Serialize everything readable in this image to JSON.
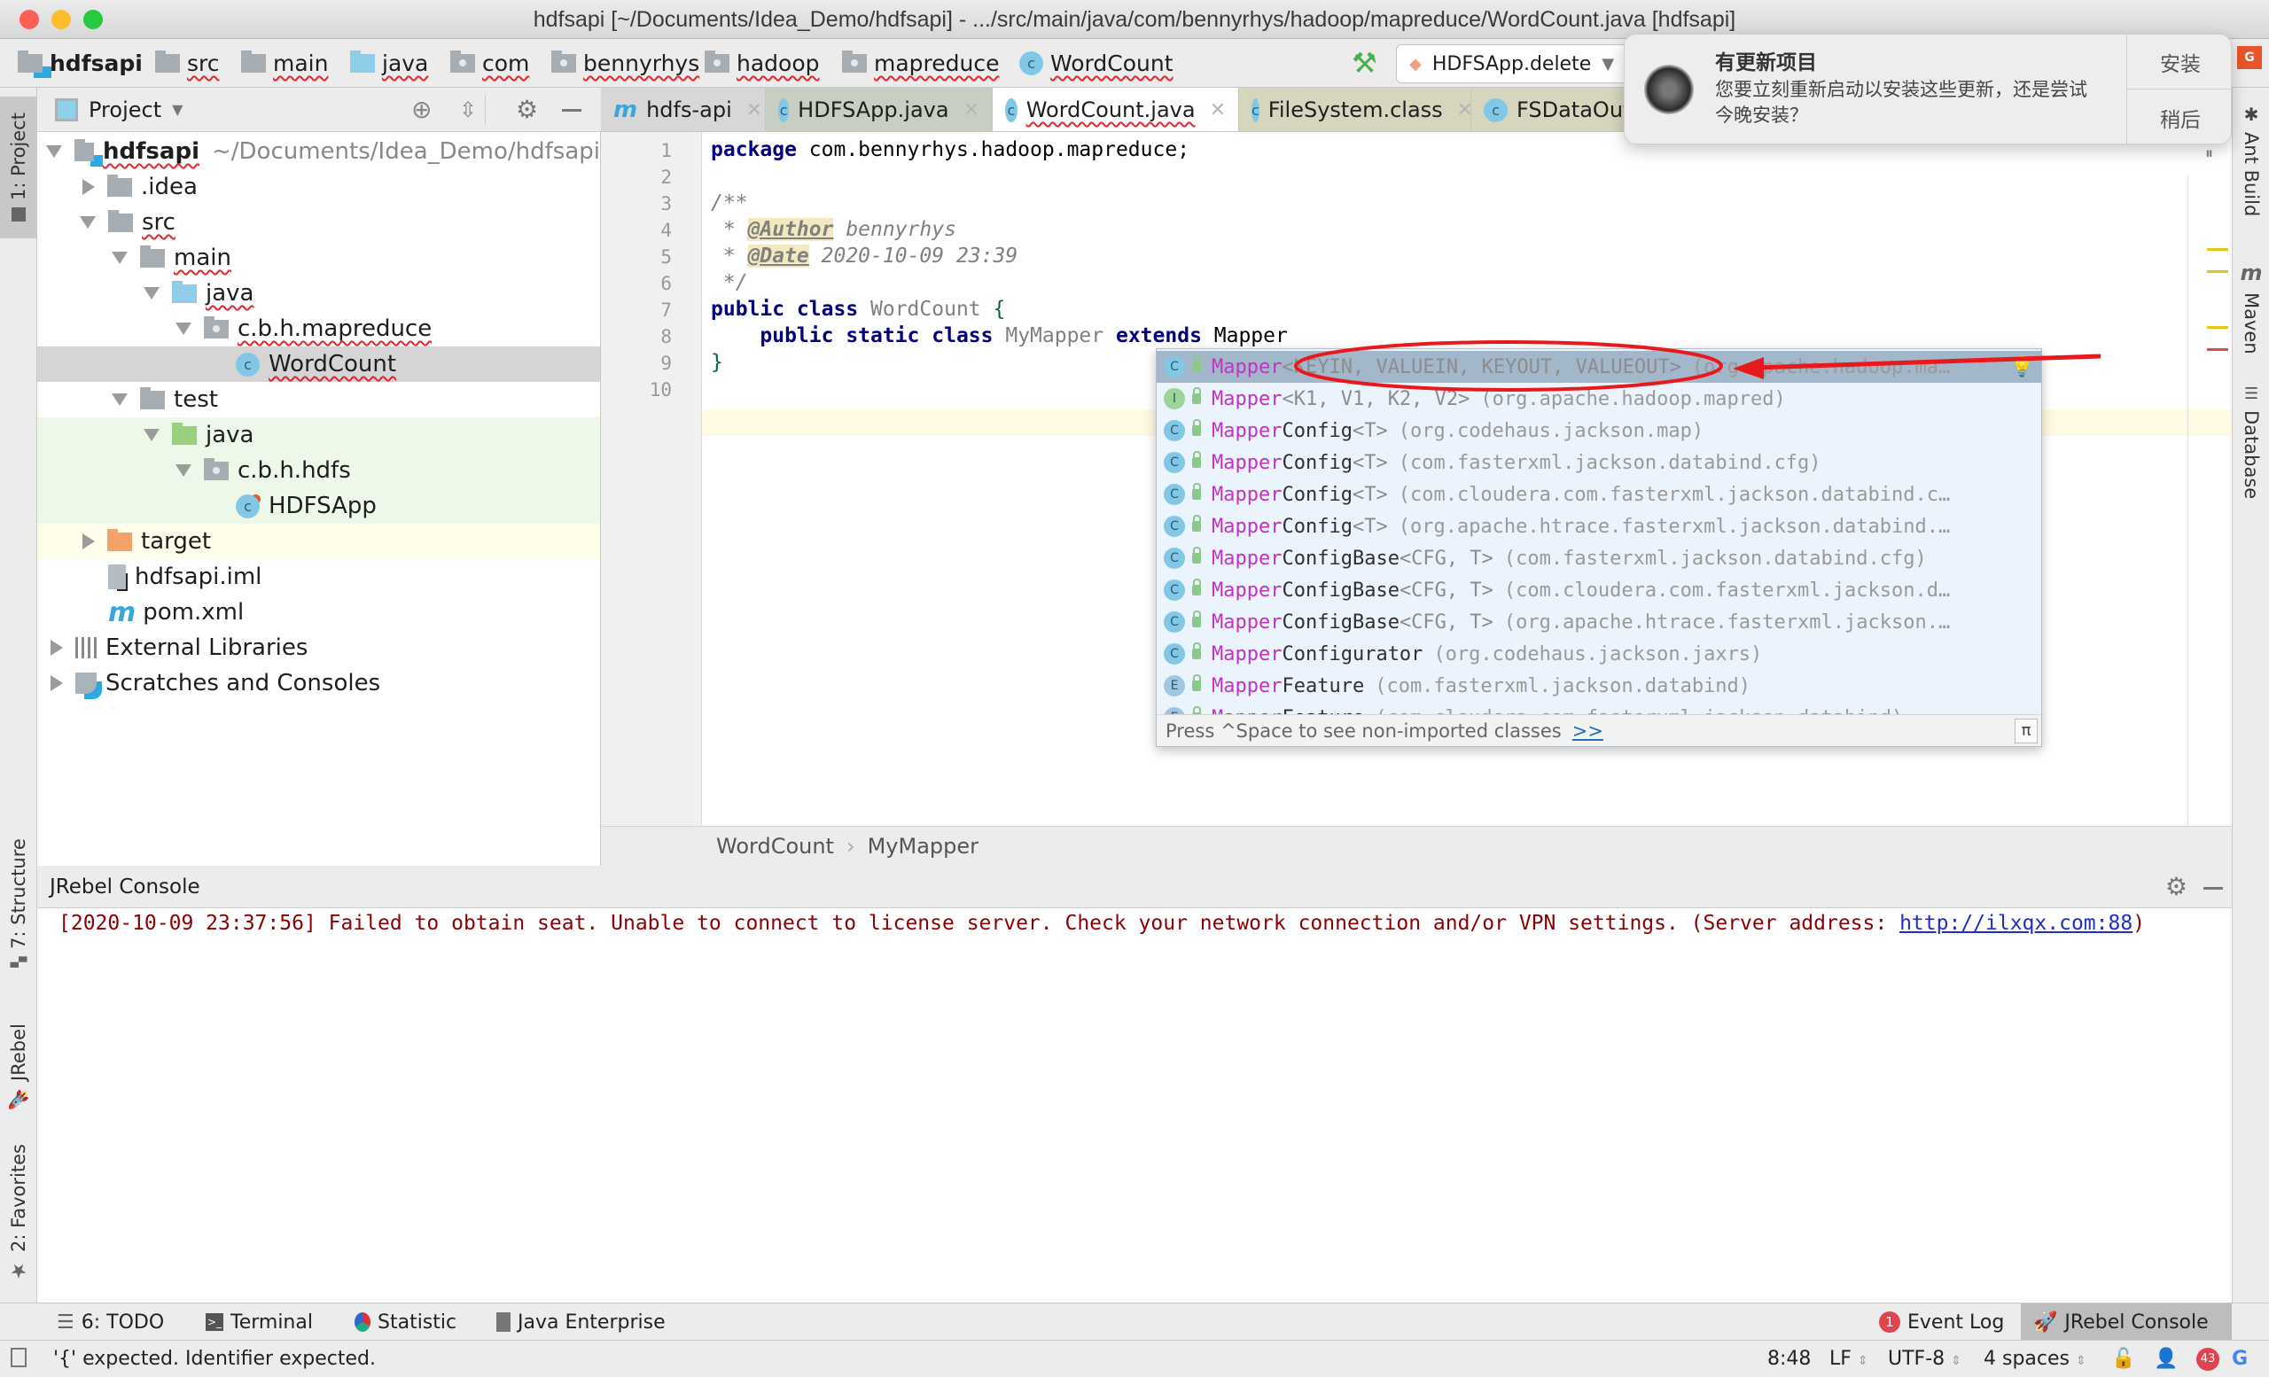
{
  "window": {
    "title": "hdfsapi [~/Documents/Idea_Demo/hdfsapi] - .../src/main/java/com/bennyrhys/hadoop/mapreduce/WordCount.java [hdfsapi]",
    "traffic_lights": {
      "close": "#fe5f57",
      "minimize": "#febc2e",
      "maximize": "#28c840"
    }
  },
  "navbar": {
    "breadcrumbs": [
      {
        "label": "hdfsapi",
        "icon": "module-folder-icon"
      },
      {
        "label": "src",
        "icon": "folder-icon"
      },
      {
        "label": "main",
        "icon": "folder-icon"
      },
      {
        "label": "java",
        "icon": "source-folder-icon"
      },
      {
        "label": "com",
        "icon": "package-icon"
      },
      {
        "label": "bennyrhys",
        "icon": "package-icon"
      },
      {
        "label": "hadoop",
        "icon": "package-icon"
      },
      {
        "label": "mapreduce",
        "icon": "package-icon"
      },
      {
        "label": "WordCount",
        "icon": "class-icon"
      }
    ],
    "run_config": "HDFSApp.delete",
    "build_icon": "hammer-icon"
  },
  "notification": {
    "title": "有更新项目",
    "message": "您要立刻重新启动以安装这些更新，还是尝试今晚安装？",
    "install_label": "安装",
    "later_label": "稍后"
  },
  "left_stripe": {
    "project": "1: Project",
    "structure": "7: Structure",
    "jrebel": "JRebel",
    "favorites": "2: Favorites"
  },
  "right_stripe": {
    "ant": "Ant Build",
    "maven": "Maven",
    "database": "Database"
  },
  "project_panel": {
    "title": "Project",
    "tree": [
      {
        "label": "hdfsapi",
        "path": "~/Documents/Idea_Demo/hdfsapi",
        "depth": 0,
        "expanded": true,
        "icon": "module-folder-icon"
      },
      {
        "label": ".idea",
        "depth": 1,
        "expanded": false,
        "icon": "folder-icon"
      },
      {
        "label": "src",
        "depth": 1,
        "expanded": true,
        "icon": "folder-icon"
      },
      {
        "label": "main",
        "depth": 2,
        "expanded": true,
        "icon": "folder-icon"
      },
      {
        "label": "java",
        "depth": 3,
        "expanded": true,
        "icon": "source-folder-icon"
      },
      {
        "label": "c.b.h.mapreduce",
        "depth": 4,
        "expanded": true,
        "icon": "package-icon"
      },
      {
        "label": "WordCount",
        "depth": 5,
        "icon": "class-icon",
        "selected": true
      },
      {
        "label": "test",
        "depth": 2,
        "expanded": true,
        "icon": "folder-icon"
      },
      {
        "label": "java",
        "depth": 3,
        "expanded": true,
        "icon": "test-folder-icon"
      },
      {
        "label": "c.b.h.hdfs",
        "depth": 4,
        "expanded": true,
        "icon": "package-icon"
      },
      {
        "label": "HDFSApp",
        "depth": 5,
        "icon": "test-class-icon"
      },
      {
        "label": "target",
        "depth": 1,
        "expanded": false,
        "icon": "excluded-folder-icon"
      },
      {
        "label": "hdfsapi.iml",
        "depth": 1,
        "icon": "iml-file-icon"
      },
      {
        "label": "pom.xml",
        "depth": 1,
        "icon": "maven-icon"
      },
      {
        "label": "External Libraries",
        "depth": 0,
        "expanded": false,
        "icon": "libraries-icon"
      },
      {
        "label": "Scratches and Consoles",
        "depth": 0,
        "expanded": false,
        "icon": "scratches-icon"
      }
    ]
  },
  "editor": {
    "tabs": [
      {
        "label": "hdfs-api",
        "icon": "maven-icon"
      },
      {
        "label": "HDFSApp.java",
        "icon": "test-class-icon"
      },
      {
        "label": "WordCount.java",
        "icon": "class-icon",
        "active": true
      },
      {
        "label": "FileSystem.class",
        "icon": "class-icon"
      },
      {
        "label": "FSDataOutp",
        "icon": "class-icon"
      }
    ],
    "line_numbers": [
      "1",
      "2",
      "3",
      "4",
      "5",
      "6",
      "7",
      "8",
      "9",
      "10"
    ],
    "code": {
      "l1_kw": "package",
      "l1_rest": " com.bennyrhys.hadoop.mapreduce;",
      "l3": "/**",
      "l4_star": " * ",
      "l4_tag": "@Author",
      "l4_val": " bennyrhys",
      "l5_star": " * ",
      "l5_tag": "@Date",
      "l5_val": " 2020-10-09 23:39",
      "l6": " */",
      "l7_kw": "public class",
      "l7_name": " WordCount ",
      "l7_brace": "{",
      "l8_indent": "    ",
      "l8_kw": "public static class",
      "l8_name": " MyMapper ",
      "l8_ext": "extends",
      "l8_rest": " Mapper",
      "l9": "}"
    },
    "breadcrumb": [
      "WordCount",
      "MyMapper"
    ],
    "cursor_line": 8
  },
  "completion": {
    "items": [
      {
        "kind": "C",
        "name": "Mapper",
        "rest": "",
        "type": "<KEYIN, VALUEIN, KEYOUT, VALUEOUT>",
        "pkg": "(org.apache.hadoop.ma…",
        "selected": true
      },
      {
        "kind": "I",
        "name": "Mapper",
        "rest": "",
        "type": "<K1, V1, K2, V2>",
        "pkg": "(org.apache.hadoop.mapred)"
      },
      {
        "kind": "C",
        "name": "Mapper",
        "rest": "Config",
        "type": "<T>",
        "pkg": "(org.codehaus.jackson.map)"
      },
      {
        "kind": "C",
        "name": "Mapper",
        "rest": "Config",
        "type": "<T>",
        "pkg": "(com.fasterxml.jackson.databind.cfg)"
      },
      {
        "kind": "C",
        "name": "Mapper",
        "rest": "Config",
        "type": "<T>",
        "pkg": "(com.cloudera.com.fasterxml.jackson.databind.c…"
      },
      {
        "kind": "C",
        "name": "Mapper",
        "rest": "Config",
        "type": "<T>",
        "pkg": "(org.apache.htrace.fasterxml.jackson.databind.…"
      },
      {
        "kind": "C",
        "name": "Mapper",
        "rest": "ConfigBase",
        "type": "<CFG, T>",
        "pkg": "(com.fasterxml.jackson.databind.cfg)"
      },
      {
        "kind": "C",
        "name": "Mapper",
        "rest": "ConfigBase",
        "type": "<CFG, T>",
        "pkg": "(com.cloudera.com.fasterxml.jackson.d…"
      },
      {
        "kind": "C",
        "name": "Mapper",
        "rest": "ConfigBase",
        "type": "<CFG, T>",
        "pkg": "(org.apache.htrace.fasterxml.jackson.…"
      },
      {
        "kind": "C",
        "name": "Mapper",
        "rest": "Configurator",
        "type": "",
        "pkg": "(org.codehaus.jackson.jaxrs)"
      },
      {
        "kind": "E",
        "name": "Mapper",
        "rest": "Feature",
        "type": "",
        "pkg": "(com.fasterxml.jackson.databind)"
      },
      {
        "kind": "E",
        "name": "Mapper",
        "rest": "Feature",
        "type": "",
        "pkg": "(com.cloudera.com.fasterxml.jackson.databind)"
      }
    ],
    "footer_hint": "Press ^Space to see non-imported classes",
    "footer_link": ">>",
    "pi_label": "π"
  },
  "console": {
    "title": "JRebel Console",
    "message": "[2020-10-09 23:37:56] Failed to obtain seat. Unable to connect to license server. Check your network connection and/or VPN settings. (Server address: ",
    "link": "http://ilxqx.com:88",
    "message_end": ")"
  },
  "bottom_tools": {
    "todo": "6: TODO",
    "terminal": "Terminal",
    "statistic": "Statistic",
    "java_enterprise": "Java Enterprise",
    "event_log": "Event Log",
    "event_log_count": "1",
    "jrebel_console": "JRebel Console"
  },
  "status": {
    "message": "'{' expected. Identifier expected.",
    "position": "8:48",
    "line_sep": "LF",
    "encoding": "UTF-8",
    "indent": "4 spaces",
    "badge_count": "43"
  }
}
